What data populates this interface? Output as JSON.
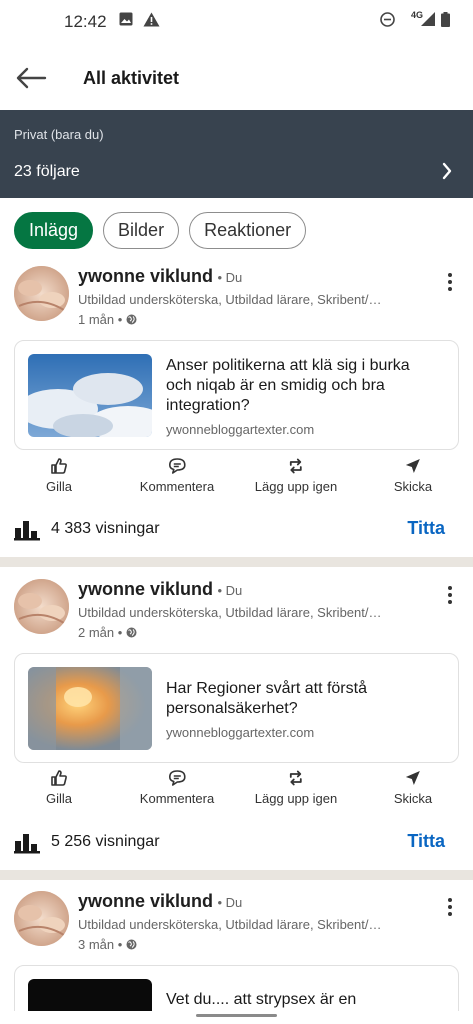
{
  "status_bar": {
    "time": "12:42",
    "network": "4G",
    "icons": [
      "gallery-icon",
      "warning-icon",
      "dnd-icon",
      "signal-icon",
      "battery-icon"
    ]
  },
  "header": {
    "title": "All aktivitet",
    "back_icon": "arrow-left-icon"
  },
  "banner": {
    "privacy": "Privat (bara du)",
    "followers": "23 följare"
  },
  "tabs": [
    {
      "label": "Inlägg",
      "active": true
    },
    {
      "label": "Bilder",
      "active": false
    },
    {
      "label": "Reaktioner",
      "active": false
    }
  ],
  "actions": {
    "like": "Gilla",
    "comment": "Kommentera",
    "repost": "Lägg upp igen",
    "send": "Skicka"
  },
  "posts": [
    {
      "author": "ywonne viklund",
      "badge": "• Du",
      "headline": "Utbildad undersköterska, Utbildad lärare, Skribent/…",
      "time": "1 mån •",
      "card_title": "Anser politikerna att klä sig i burka och niqab är en smidig och bra integration?",
      "card_source": "ywonnebloggartexter.com",
      "views": "4 383 visningar",
      "view_action": "Titta"
    },
    {
      "author": "ywonne viklund",
      "badge": "• Du",
      "headline": "Utbildad undersköterska, Utbildad lärare, Skribent/…",
      "time": "2 mån •",
      "card_title": "Har Regioner svårt att förstå personalsäkerhet?",
      "card_source": "ywonnebloggartexter.com",
      "views": "5 256 visningar",
      "view_action": "Titta"
    },
    {
      "author": "ywonne viklund",
      "badge": "• Du",
      "headline": "Utbildad undersköterska, Utbildad lärare, Skribent/…",
      "time": "3 mån •",
      "card_title": "Vet du.... att strypsex är en"
    }
  ],
  "colors": {
    "banner_bg": "#38434f",
    "tab_active": "#057642",
    "link_blue": "#0a66c2",
    "divider": "#e9e5df"
  }
}
